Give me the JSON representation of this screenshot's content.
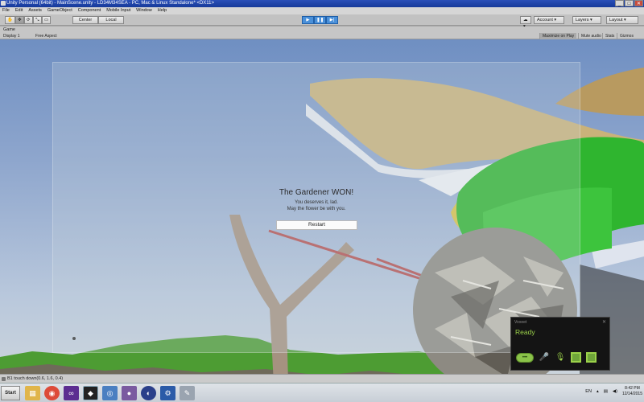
{
  "window": {
    "title": "Unity Personal (64bit) - MainScene.unity - LD34M34SEA - PC, Mac & Linux Standalone* <DX11>",
    "buttons": [
      "_",
      "□",
      "✕"
    ]
  },
  "menu": {
    "items": [
      "File",
      "Edit",
      "Assets",
      "GameObject",
      "Component",
      "Mobile Input",
      "Window",
      "Help"
    ]
  },
  "toolbar": {
    "pivot_label": "Center",
    "space_label": "Local",
    "account_label": "Account",
    "layers_label": "Layers",
    "layout_label": "Layout",
    "tools": [
      "✋",
      "✥",
      "⟳",
      "⤡",
      "▭"
    ],
    "play_icons": [
      "▶",
      "❚❚",
      "▶|"
    ]
  },
  "game_view": {
    "tab_label": "Game",
    "display_label": "Display 1",
    "aspect_label": "Free Aspect",
    "right_buttons": [
      "Maximize on Play",
      "Mute audio",
      "Stats",
      "Gizmos"
    ]
  },
  "end_screen": {
    "title": "The Gardener WON!",
    "line1": "You deserves it, lad.",
    "line2": "May the flower be with you.",
    "restart_label": "Restart"
  },
  "voice_panel": {
    "title": "Voxeet",
    "status": "Ready",
    "close": "✕",
    "pill_label": "•••"
  },
  "console": {
    "message": "B1 touch down(0.6, 1.6, 0.4)"
  },
  "taskbar": {
    "start_label": "Start",
    "apps": [
      {
        "icon": "folder",
        "color": "#e0b54a",
        "glyph": "▦"
      },
      {
        "icon": "chrome",
        "color": "#dd4b39",
        "glyph": "◉"
      },
      {
        "icon": "visual-studio",
        "color": "#5c2d91",
        "glyph": "∞"
      },
      {
        "icon": "unity",
        "color": "#222222",
        "glyph": "◆"
      },
      {
        "icon": "monodevelop",
        "color": "#4a7fc1",
        "glyph": "◎"
      },
      {
        "icon": "github",
        "color": "#7a5aa0",
        "glyph": "●"
      },
      {
        "icon": "vlc",
        "color": "#2a3f8a",
        "glyph": "◐"
      },
      {
        "icon": "settings",
        "color": "#2b5ba8",
        "glyph": "⚙"
      },
      {
        "icon": "paint",
        "color": "#9aa4b0",
        "glyph": "✎"
      }
    ],
    "language": "EN",
    "time": "8:42 PM",
    "date": "12/14/2015"
  }
}
